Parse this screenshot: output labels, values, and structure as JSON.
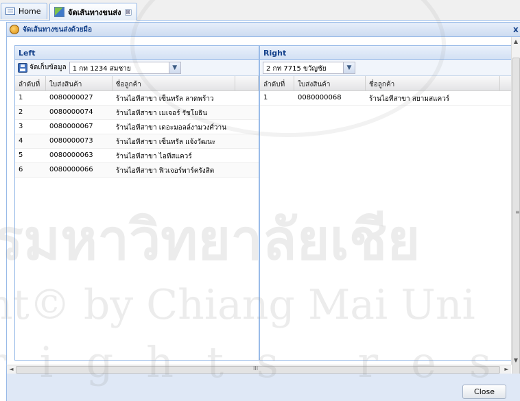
{
  "tabs": [
    {
      "label": "Home",
      "icon": "home-icon"
    },
    {
      "label": "จัดเส้นทางขนส่ง",
      "icon": "route-icon",
      "close": "⊠"
    }
  ],
  "window": {
    "title": "จัดเส้นทางขนส่งด้วยมือ",
    "close": "x"
  },
  "left": {
    "title": "Left",
    "save_label": "จัดเก็บข้อมูล",
    "combo_value": "1 กท 1234 สมชาย",
    "columns": [
      "ลำดับที่",
      "ใบส่งสินค้า",
      "ชื่อลูกค้า"
    ],
    "rows": [
      [
        "1",
        "0080000027",
        "ร้านไอทีสาขา เซ็นทรัล ลาดพร้าว"
      ],
      [
        "2",
        "0080000074",
        "ร้านไอทีสาขา เมเจอร์ รัชโยธิน"
      ],
      [
        "3",
        "0080000067",
        "ร้านไอทีสาขา เดอะมอลล์งามวงศ์วาน"
      ],
      [
        "4",
        "0080000073",
        "ร้านไอทีสาขา เซ็นทรัล แจ้งวัฒนะ"
      ],
      [
        "5",
        "0080000063",
        "ร้านไอทีสาขา ไอทีสแควร์"
      ],
      [
        "6",
        "0080000066",
        "ร้านไอทีสาขา ฟิวเจอร์พาร์ครังสิต"
      ]
    ]
  },
  "right": {
    "title": "Right",
    "combo_value": "2 กท 7715 ขวัญชัย",
    "columns": [
      "ลำดับที่",
      "ใบส่งสินค้า",
      "ชื่อลูกค้า"
    ],
    "rows": [
      [
        "1",
        "0080000068",
        "ร้านไอทีสาขา สยามสแควร์"
      ]
    ]
  },
  "scroll": {
    "v_grip": "≡",
    "h_grip": "III",
    "left": "◄",
    "right": "►",
    "up": "▲",
    "down": "▼"
  },
  "footer": {
    "close_label": "Close"
  },
  "watermark": {
    "line1": "รมหาวิทยาลัยเชีย",
    "line2": "ht© by Chiang Mai Uni",
    "line3": "rights reser"
  }
}
